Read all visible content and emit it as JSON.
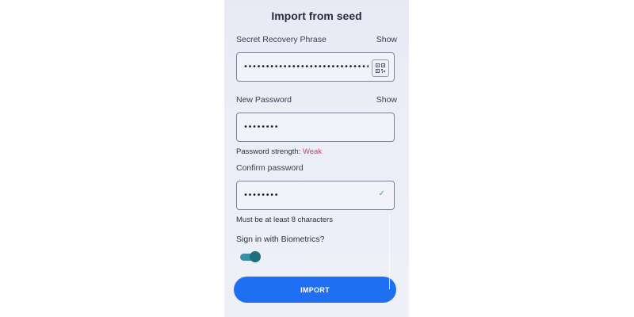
{
  "screen": {
    "title": "Import from seed"
  },
  "seed": {
    "label": "Secret Recovery Phrase",
    "show_label": "Show",
    "value": "••••••••••••••••••••••••••••••••••••••••••",
    "qr_icon": "qr-scan-icon"
  },
  "new_password": {
    "label": "New Password",
    "show_label": "Show",
    "value": "••••••••",
    "strength_prefix": "Password strength: ",
    "strength_value": "Weak"
  },
  "confirm_password": {
    "label": "Confirm password",
    "value": "••••••••",
    "match_icon": "check-icon",
    "hint": "Must be at least 8 characters"
  },
  "biometrics": {
    "label": "Sign in with Biometrics?",
    "enabled": true
  },
  "import_button": {
    "label": "IMPORT"
  },
  "colors": {
    "accent": "#1f6ff2",
    "weak": "#d13f63",
    "toggle_on": "#1f6f7e",
    "check": "#3aa6a0"
  }
}
